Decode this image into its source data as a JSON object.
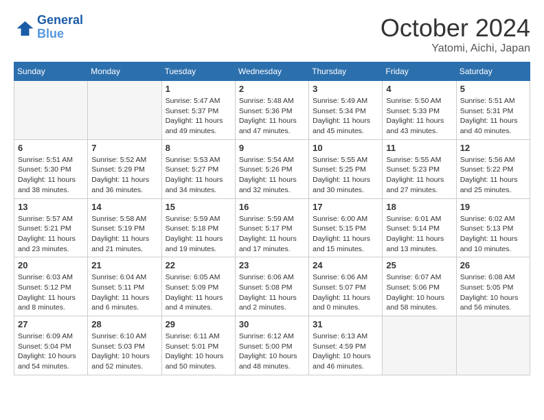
{
  "header": {
    "logo_line1": "General",
    "logo_line2": "Blue",
    "month": "October 2024",
    "location": "Yatomi, Aichi, Japan"
  },
  "days_of_week": [
    "Sunday",
    "Monday",
    "Tuesday",
    "Wednesday",
    "Thursday",
    "Friday",
    "Saturday"
  ],
  "weeks": [
    [
      {
        "day": "",
        "info": ""
      },
      {
        "day": "",
        "info": ""
      },
      {
        "day": "1",
        "info": "Sunrise: 5:47 AM\nSunset: 5:37 PM\nDaylight: 11 hours and 49 minutes."
      },
      {
        "day": "2",
        "info": "Sunrise: 5:48 AM\nSunset: 5:36 PM\nDaylight: 11 hours and 47 minutes."
      },
      {
        "day": "3",
        "info": "Sunrise: 5:49 AM\nSunset: 5:34 PM\nDaylight: 11 hours and 45 minutes."
      },
      {
        "day": "4",
        "info": "Sunrise: 5:50 AM\nSunset: 5:33 PM\nDaylight: 11 hours and 43 minutes."
      },
      {
        "day": "5",
        "info": "Sunrise: 5:51 AM\nSunset: 5:31 PM\nDaylight: 11 hours and 40 minutes."
      }
    ],
    [
      {
        "day": "6",
        "info": "Sunrise: 5:51 AM\nSunset: 5:30 PM\nDaylight: 11 hours and 38 minutes."
      },
      {
        "day": "7",
        "info": "Sunrise: 5:52 AM\nSunset: 5:29 PM\nDaylight: 11 hours and 36 minutes."
      },
      {
        "day": "8",
        "info": "Sunrise: 5:53 AM\nSunset: 5:27 PM\nDaylight: 11 hours and 34 minutes."
      },
      {
        "day": "9",
        "info": "Sunrise: 5:54 AM\nSunset: 5:26 PM\nDaylight: 11 hours and 32 minutes."
      },
      {
        "day": "10",
        "info": "Sunrise: 5:55 AM\nSunset: 5:25 PM\nDaylight: 11 hours and 30 minutes."
      },
      {
        "day": "11",
        "info": "Sunrise: 5:55 AM\nSunset: 5:23 PM\nDaylight: 11 hours and 27 minutes."
      },
      {
        "day": "12",
        "info": "Sunrise: 5:56 AM\nSunset: 5:22 PM\nDaylight: 11 hours and 25 minutes."
      }
    ],
    [
      {
        "day": "13",
        "info": "Sunrise: 5:57 AM\nSunset: 5:21 PM\nDaylight: 11 hours and 23 minutes."
      },
      {
        "day": "14",
        "info": "Sunrise: 5:58 AM\nSunset: 5:19 PM\nDaylight: 11 hours and 21 minutes."
      },
      {
        "day": "15",
        "info": "Sunrise: 5:59 AM\nSunset: 5:18 PM\nDaylight: 11 hours and 19 minutes."
      },
      {
        "day": "16",
        "info": "Sunrise: 5:59 AM\nSunset: 5:17 PM\nDaylight: 11 hours and 17 minutes."
      },
      {
        "day": "17",
        "info": "Sunrise: 6:00 AM\nSunset: 5:15 PM\nDaylight: 11 hours and 15 minutes."
      },
      {
        "day": "18",
        "info": "Sunrise: 6:01 AM\nSunset: 5:14 PM\nDaylight: 11 hours and 13 minutes."
      },
      {
        "day": "19",
        "info": "Sunrise: 6:02 AM\nSunset: 5:13 PM\nDaylight: 11 hours and 10 minutes."
      }
    ],
    [
      {
        "day": "20",
        "info": "Sunrise: 6:03 AM\nSunset: 5:12 PM\nDaylight: 11 hours and 8 minutes."
      },
      {
        "day": "21",
        "info": "Sunrise: 6:04 AM\nSunset: 5:11 PM\nDaylight: 11 hours and 6 minutes."
      },
      {
        "day": "22",
        "info": "Sunrise: 6:05 AM\nSunset: 5:09 PM\nDaylight: 11 hours and 4 minutes."
      },
      {
        "day": "23",
        "info": "Sunrise: 6:06 AM\nSunset: 5:08 PM\nDaylight: 11 hours and 2 minutes."
      },
      {
        "day": "24",
        "info": "Sunrise: 6:06 AM\nSunset: 5:07 PM\nDaylight: 11 hours and 0 minutes."
      },
      {
        "day": "25",
        "info": "Sunrise: 6:07 AM\nSunset: 5:06 PM\nDaylight: 10 hours and 58 minutes."
      },
      {
        "day": "26",
        "info": "Sunrise: 6:08 AM\nSunset: 5:05 PM\nDaylight: 10 hours and 56 minutes."
      }
    ],
    [
      {
        "day": "27",
        "info": "Sunrise: 6:09 AM\nSunset: 5:04 PM\nDaylight: 10 hours and 54 minutes."
      },
      {
        "day": "28",
        "info": "Sunrise: 6:10 AM\nSunset: 5:03 PM\nDaylight: 10 hours and 52 minutes."
      },
      {
        "day": "29",
        "info": "Sunrise: 6:11 AM\nSunset: 5:01 PM\nDaylight: 10 hours and 50 minutes."
      },
      {
        "day": "30",
        "info": "Sunrise: 6:12 AM\nSunset: 5:00 PM\nDaylight: 10 hours and 48 minutes."
      },
      {
        "day": "31",
        "info": "Sunrise: 6:13 AM\nSunset: 4:59 PM\nDaylight: 10 hours and 46 minutes."
      },
      {
        "day": "",
        "info": ""
      },
      {
        "day": "",
        "info": ""
      }
    ]
  ]
}
